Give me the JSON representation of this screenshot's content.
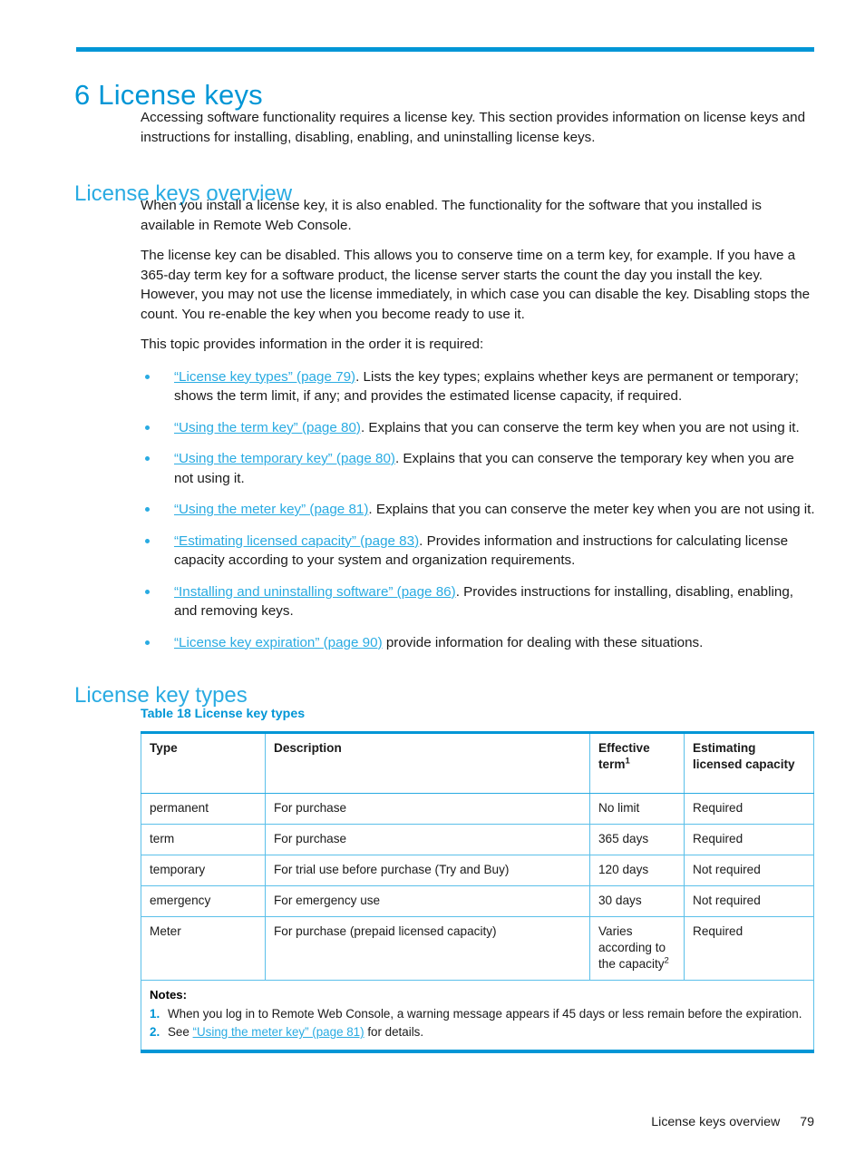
{
  "colors": {
    "rule": "#0096d6",
    "heading": "#0096d6",
    "subheading": "#29abe2",
    "link": "#29abe2",
    "table_border": "#5bc0ea",
    "text": "#1a1a1a"
  },
  "chapter": {
    "number": "6",
    "title": "6 License keys"
  },
  "intro": {
    "paragraph": "Accessing software functionality requires a license key. This section provides information on license keys and instructions for installing, disabling, enabling, and uninstalling license keys."
  },
  "sections": [
    {
      "id": "license-keys-overview",
      "heading": "License keys overview",
      "paragraphs": [
        "When you install a license key, it is also enabled. The functionality for the software that you installed is available in Remote Web Console.",
        "The license key can be disabled. This allows you to conserve time on a term key, for example. If you have a 365-day term key for a software product, the license server starts the count the day you install the key. However, you may not use the license immediately, in which case you can disable the key. Disabling stops the count. You re-enable the key when you become ready to use it.",
        "This topic provides information in the order it is required:"
      ],
      "bullets": [
        {
          "link": "“License key types” (page 79)",
          "text": ". Lists the key types; explains whether keys are permanent or temporary; shows the term limit, if any; and provides the estimated license capacity, if required."
        },
        {
          "link": "“Using the term key” (page 80)",
          "text": ". Explains that you can conserve the term key when you are not using it."
        },
        {
          "link": "“Using the temporary key” (page 80)",
          "text": ". Explains that you can conserve the temporary key when you are not using it."
        },
        {
          "link": "“Using the meter key” (page 81)",
          "text": ". Explains that you can conserve the meter key when you are not using it."
        },
        {
          "link": "“Estimating licensed capacity” (page 83)",
          "text": ". Provides information and instructions for calculating license capacity according to your system and organization requirements."
        },
        {
          "link": "“Installing and uninstalling software” (page 86)",
          "text": ". Provides instructions for installing, disabling, enabling, and removing keys."
        },
        {
          "link": "“License key expiration” (page 90)",
          "text": " provide information for dealing with these situations."
        }
      ]
    },
    {
      "id": "license-key-types",
      "heading": "License key types"
    }
  ],
  "table": {
    "caption": "Table 18 License key types",
    "columns": [
      {
        "label": "Type",
        "sup": ""
      },
      {
        "label": "Description",
        "sup": ""
      },
      {
        "label": "Effective term",
        "sup": "1"
      },
      {
        "label": "Estimating licensed capacity",
        "sup": ""
      }
    ],
    "rows": [
      {
        "type": "permanent",
        "description": "For purchase",
        "term": "No limit",
        "term_sup": "",
        "capacity": "Required"
      },
      {
        "type": "term",
        "description": "For purchase",
        "term": "365 days",
        "term_sup": "",
        "capacity": "Required"
      },
      {
        "type": "temporary",
        "description": "For trial use before purchase (Try and Buy)",
        "term": "120 days",
        "term_sup": "",
        "capacity": "Not required"
      },
      {
        "type": "emergency",
        "description": "For emergency use",
        "term": "30 days",
        "term_sup": "",
        "capacity": "Not required"
      },
      {
        "type": "Meter",
        "description": "For purchase (prepaid licensed capacity)",
        "term": "Varies according to the capacity",
        "term_sup": "2",
        "capacity": "Required"
      }
    ],
    "notes": {
      "title": "Notes:",
      "items": [
        {
          "number": "1.",
          "text": "When you log in to Remote Web Console, a warning message appears if 45 days or less remain before the expiration.",
          "link": "",
          "text_after": ""
        },
        {
          "number": "2.",
          "text": "See ",
          "link": "“Using the meter key” (page 81)",
          "text_after": " for details."
        }
      ]
    }
  },
  "footer": {
    "running_head": "License keys overview",
    "page_number": "79"
  }
}
